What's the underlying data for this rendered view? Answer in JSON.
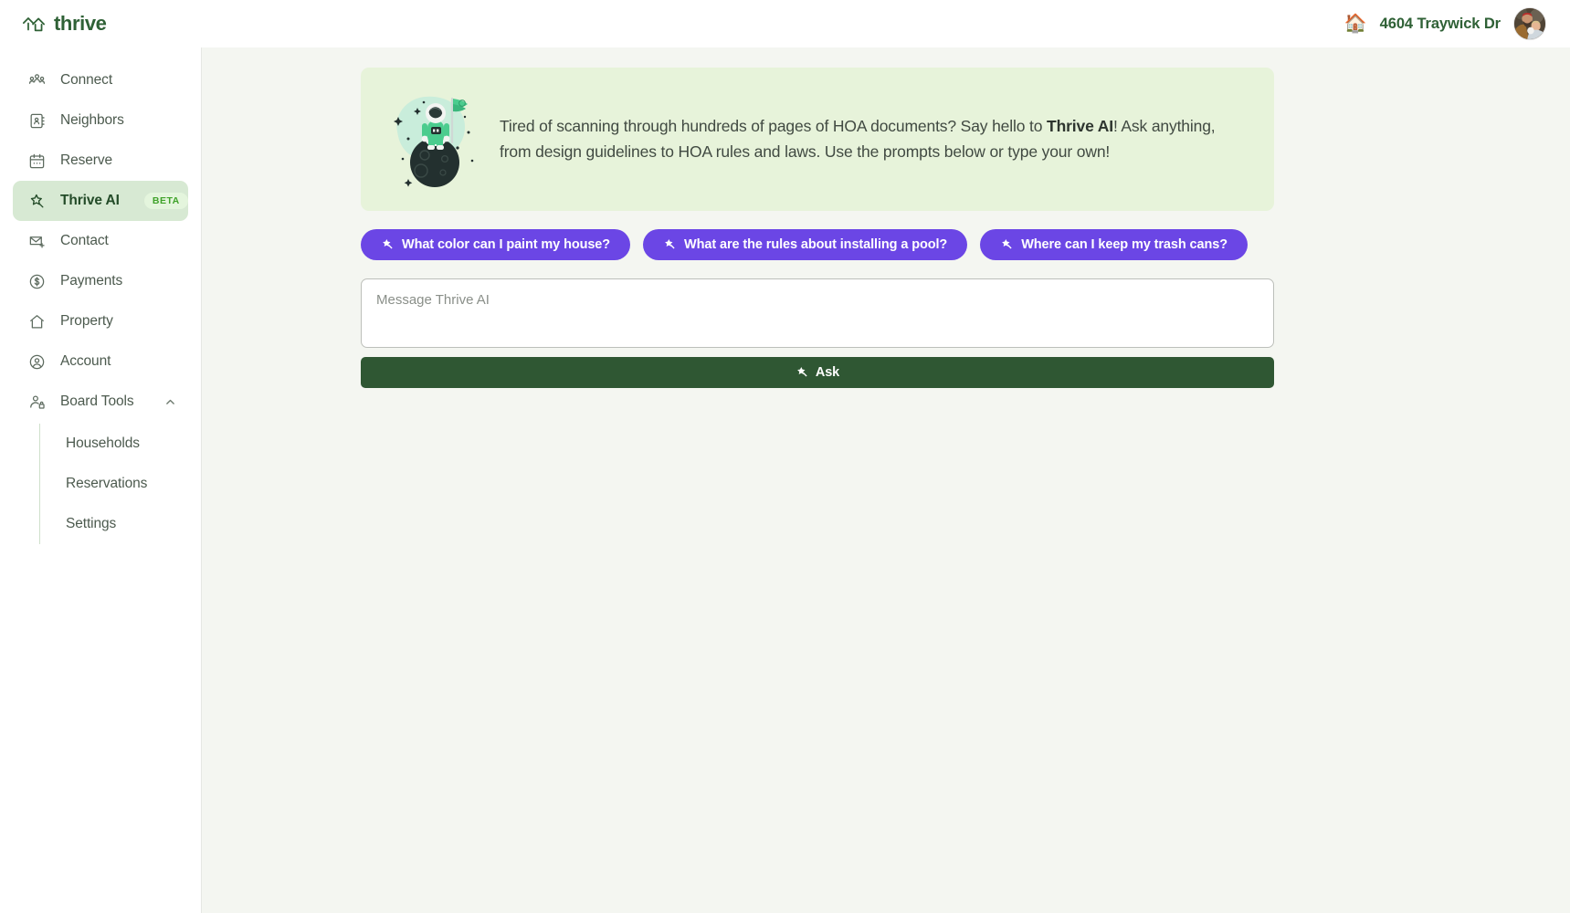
{
  "brand": {
    "name": "thrive",
    "logo_icon": "house-roof-icon",
    "color": "#2f6136"
  },
  "header": {
    "property_emoji": "🏠",
    "property_address": "4604 Traywick Dr",
    "avatar_icon": "user-avatar-photo"
  },
  "sidebar": {
    "items": [
      {
        "label": "Connect",
        "icon": "people-group-icon",
        "active": false
      },
      {
        "label": "Neighbors",
        "icon": "contact-book-icon",
        "active": false
      },
      {
        "label": "Reserve",
        "icon": "calendar-icon",
        "active": false
      },
      {
        "label": "Thrive AI",
        "icon": "magic-wand-icon",
        "active": true,
        "badge": "BETA"
      },
      {
        "label": "Contact",
        "icon": "envelope-plus-icon",
        "active": false
      },
      {
        "label": "Payments",
        "icon": "dollar-circle-icon",
        "active": false
      },
      {
        "label": "Property",
        "icon": "home-icon",
        "active": false
      },
      {
        "label": "Account",
        "icon": "user-circle-icon",
        "active": false
      },
      {
        "label": "Board Tools",
        "icon": "user-lock-icon",
        "active": false,
        "expanded": true,
        "chevron": "chevron-up-icon"
      }
    ],
    "subitems": [
      {
        "label": "Households"
      },
      {
        "label": "Reservations"
      },
      {
        "label": "Settings"
      }
    ],
    "active_color": "#d7e9d3",
    "badge_bg": "#e4f5dd",
    "badge_color": "#3fa22a"
  },
  "banner": {
    "illustration": "astronaut-on-moon-with-flag-illustration",
    "background": "#e7f3da",
    "line1_prefix": "Tired of scanning through hundreds of pages of HOA documents? Say hello to ",
    "line1_bold": "Thrive AI",
    "line1_suffix": "! Ask anything, from design guidelines to HOA rules and laws. Use the prompts below or type your own!"
  },
  "prompts": {
    "color": "#6b46e5",
    "icon": "magic-wand-icon",
    "chips": [
      {
        "label": "What color can I paint my house?"
      },
      {
        "label": "What are the rules about installing a pool?"
      },
      {
        "label": "Where can I keep my trash cans?"
      }
    ]
  },
  "composer": {
    "placeholder": "Message Thrive AI",
    "value": ""
  },
  "ask_button": {
    "label": "Ask",
    "icon": "magic-wand-icon",
    "color": "#2f5733"
  }
}
